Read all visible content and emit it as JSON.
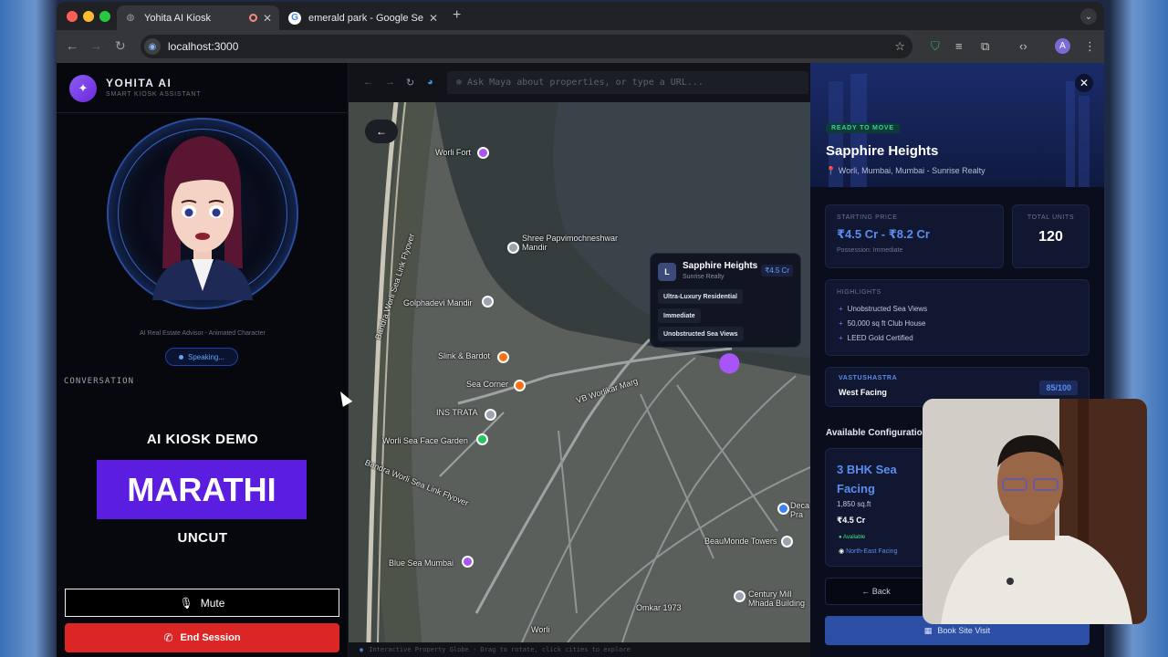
{
  "browser": {
    "tabs": [
      {
        "title": "Yohita AI Kiosk",
        "active": true
      },
      {
        "title": "emerald park - Google Search",
        "active": false
      }
    ],
    "url": "localhost:3000"
  },
  "left_panel": {
    "brand_name": "YOHITA AI",
    "brand_sub": "SMART KIOSK ASSISTANT",
    "avatar_caption": "AI Real Estate Advisor - Animated Character",
    "status": "Speaking...",
    "conversation_label": "CONVERSATION",
    "demo_title": "AI KIOSK DEMO",
    "demo_language": "MARATHI",
    "demo_sub": "UNCUT",
    "mute_label": "Mute",
    "end_label": "End Session",
    "colors": {
      "accent": "#5b1ee0",
      "danger": "#dc2626"
    }
  },
  "map": {
    "search_placeholder": "Ask Maya about properties, or type a URL...",
    "labels": {
      "worli_fort": "Worli Fort",
      "shree": "Shree Papvimochneshwar\nMandir",
      "golphadevi": "Golphadevi Mandir",
      "slink": "Slink & Bardot",
      "sea_corner": "Sea Corner",
      "ins_trata": "INS TRATA",
      "worli_sea_face": "Worli Sea Face Garden",
      "blue_sea": "Blue Sea Mumbai",
      "beaumonde": "BeauMonde Towers",
      "century": "Century Mill\nMhada Building",
      "omkar": "Omkar 1973",
      "sea_link_1": "Bandra Worli Sea Link Flyover",
      "sea_link_2": "Bandra Worli Sea Link Flyover",
      "vb_worlikar": "VB Worlikar Marg",
      "worli": "Worli",
      "decan": "Deca\nPra"
    },
    "card": {
      "initial": "L",
      "name": "Sapphire Heights",
      "developer": "Sunrise Realty",
      "price": "₹4.5 Cr",
      "tags": [
        "Ultra-Luxury Residential",
        "Immediate",
        "Unobstructed Sea Views"
      ]
    },
    "footer": "Interactive Property Globe - Drag to rotate, click cities to explore"
  },
  "property": {
    "status_badge": "READY TO MOVE",
    "name": "Sapphire Heights",
    "location": "Worli, Mumbai, Mumbai - Sunrise Realty",
    "starting_price_label": "STARTING PRICE",
    "starting_price": "₹4.5 Cr - ₹8.2 Cr",
    "possession": "Possession: Immediate",
    "total_units_label": "TOTAL UNITS",
    "total_units": "120",
    "highlights_label": "HIGHLIGHTS",
    "highlights": [
      "Unobstructed Sea Views",
      "50,000 sq ft Club House",
      "LEED Gold Certified"
    ],
    "vastu_label": "VASTUSHASTRA",
    "vastu_value": "West Facing",
    "vastu_score": "85/100",
    "available_title": "Available Configurations",
    "config": {
      "name": "3 BHK Sea Facing",
      "area": "1,850 sq.ft",
      "price": "₹4.5 Cr",
      "availability": "Available",
      "facing": "North-East Facing"
    },
    "back_label": "← Back",
    "book_label": "Book Site Visit"
  }
}
